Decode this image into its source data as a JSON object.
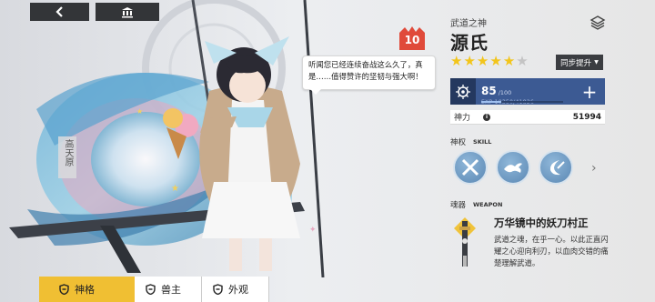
{
  "top": {
    "back_icon": "chevron-left-icon",
    "home_icon": "bank-icon"
  },
  "bubble": {
    "text": "听闻您已经连续奋战这么久了，真是……值得赞许的坚韧与强大啊！"
  },
  "vertical_text": "高天原",
  "character": {
    "rank": "10",
    "subtitle": "武道之神",
    "name": "源氏",
    "stars_filled": 5,
    "stars_total": 6,
    "sync_label": "同步提升",
    "level": "85",
    "level_max": "/100",
    "exp": "EXP  10350/41826",
    "exp_progress": 0.247,
    "power_label": "神力",
    "power_value": "51994"
  },
  "skills": {
    "label": "神权",
    "label_en": "SKILL",
    "icons": [
      "crossed-blades-skill-icon",
      "dragon-skill-icon",
      "crescent-slash-skill-icon"
    ]
  },
  "weapon": {
    "label": "魂器",
    "label_en": "WEAPON",
    "name": "万华镜中的妖刀村正",
    "description": "武道之魂，在乎一心。以此正直闪耀之心迎向利刃，以血肉交错的痛楚理解武道。"
  },
  "tabs": [
    {
      "label": "神格",
      "icon": "shield-icon",
      "active": true
    },
    {
      "label": "兽主",
      "icon": "shield-icon",
      "active": false
    },
    {
      "label": "外观",
      "icon": "shield-icon",
      "active": false
    }
  ],
  "colors": {
    "accent_yellow": "#f0bf33",
    "level_blue": "#3c5a93",
    "rank_red": "#e04a3a",
    "star": "#f2c51b"
  }
}
